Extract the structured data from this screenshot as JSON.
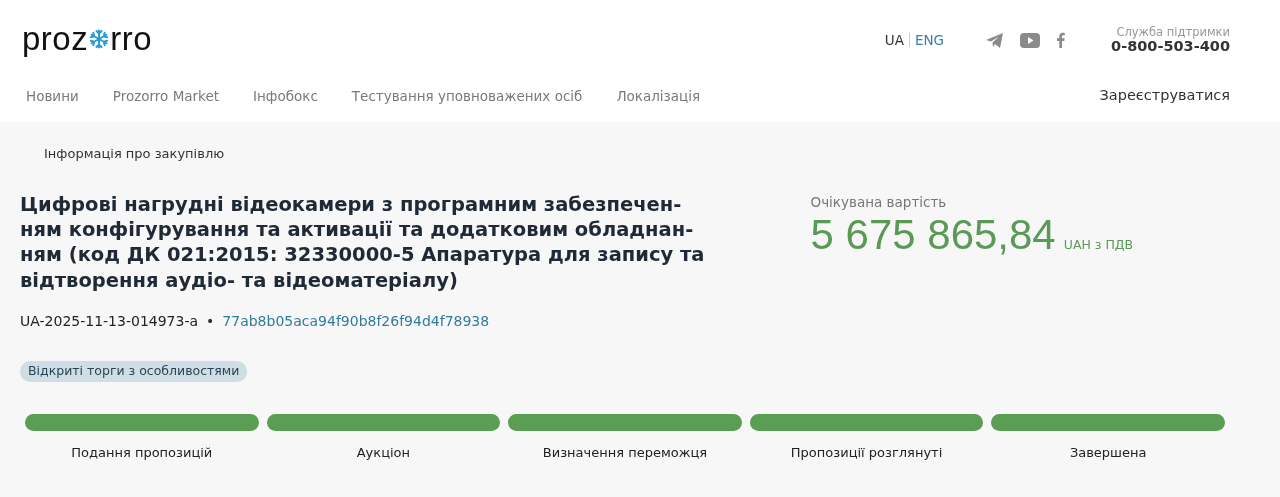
{
  "logo": {
    "before": "proz",
    "after": "rro"
  },
  "languages": [
    {
      "label": "UA",
      "selected": true
    },
    {
      "label": "ENG",
      "selected": false
    }
  ],
  "support": {
    "label": "Служба підтримки",
    "phone": "0-800-503-400"
  },
  "nav": [
    "Новини",
    "Prozorro Market",
    "Інфобокс",
    "Тестування уповноважених осіб",
    "Локалізація"
  ],
  "register": "Зареєструватися",
  "breadcrumb": "Інформація про закупівлю",
  "title_lines": [
    "Цифрові нагрудні відеокамери з програмним забезпечен-",
    "ням конфігурування та активації та додатковим обладнан-",
    "ням (код ДК 021:2015: 32330000-5 Апаратура для запису та",
    "відтворення аудіо- та відеоматеріалу)"
  ],
  "tender_id": "UA-2025-11-13-014973-a",
  "separator": "•",
  "hash": "77ab8b05aca94f90b8f26f94d4f78938",
  "procedure": "Відкриті торги з особливостями",
  "value": {
    "label": "Очікувана вартість",
    "amount": "5 675 865,84",
    "currency": "UAH з ПДВ"
  },
  "stages": [
    {
      "label": "Подання пропозицій",
      "completed": true
    },
    {
      "label": "Аукціон",
      "completed": true
    },
    {
      "label": "Визначення переможця",
      "completed": true
    },
    {
      "label": "Пропозиції розглянуті",
      "completed": true
    },
    {
      "label": "Завершена",
      "completed": true
    }
  ]
}
